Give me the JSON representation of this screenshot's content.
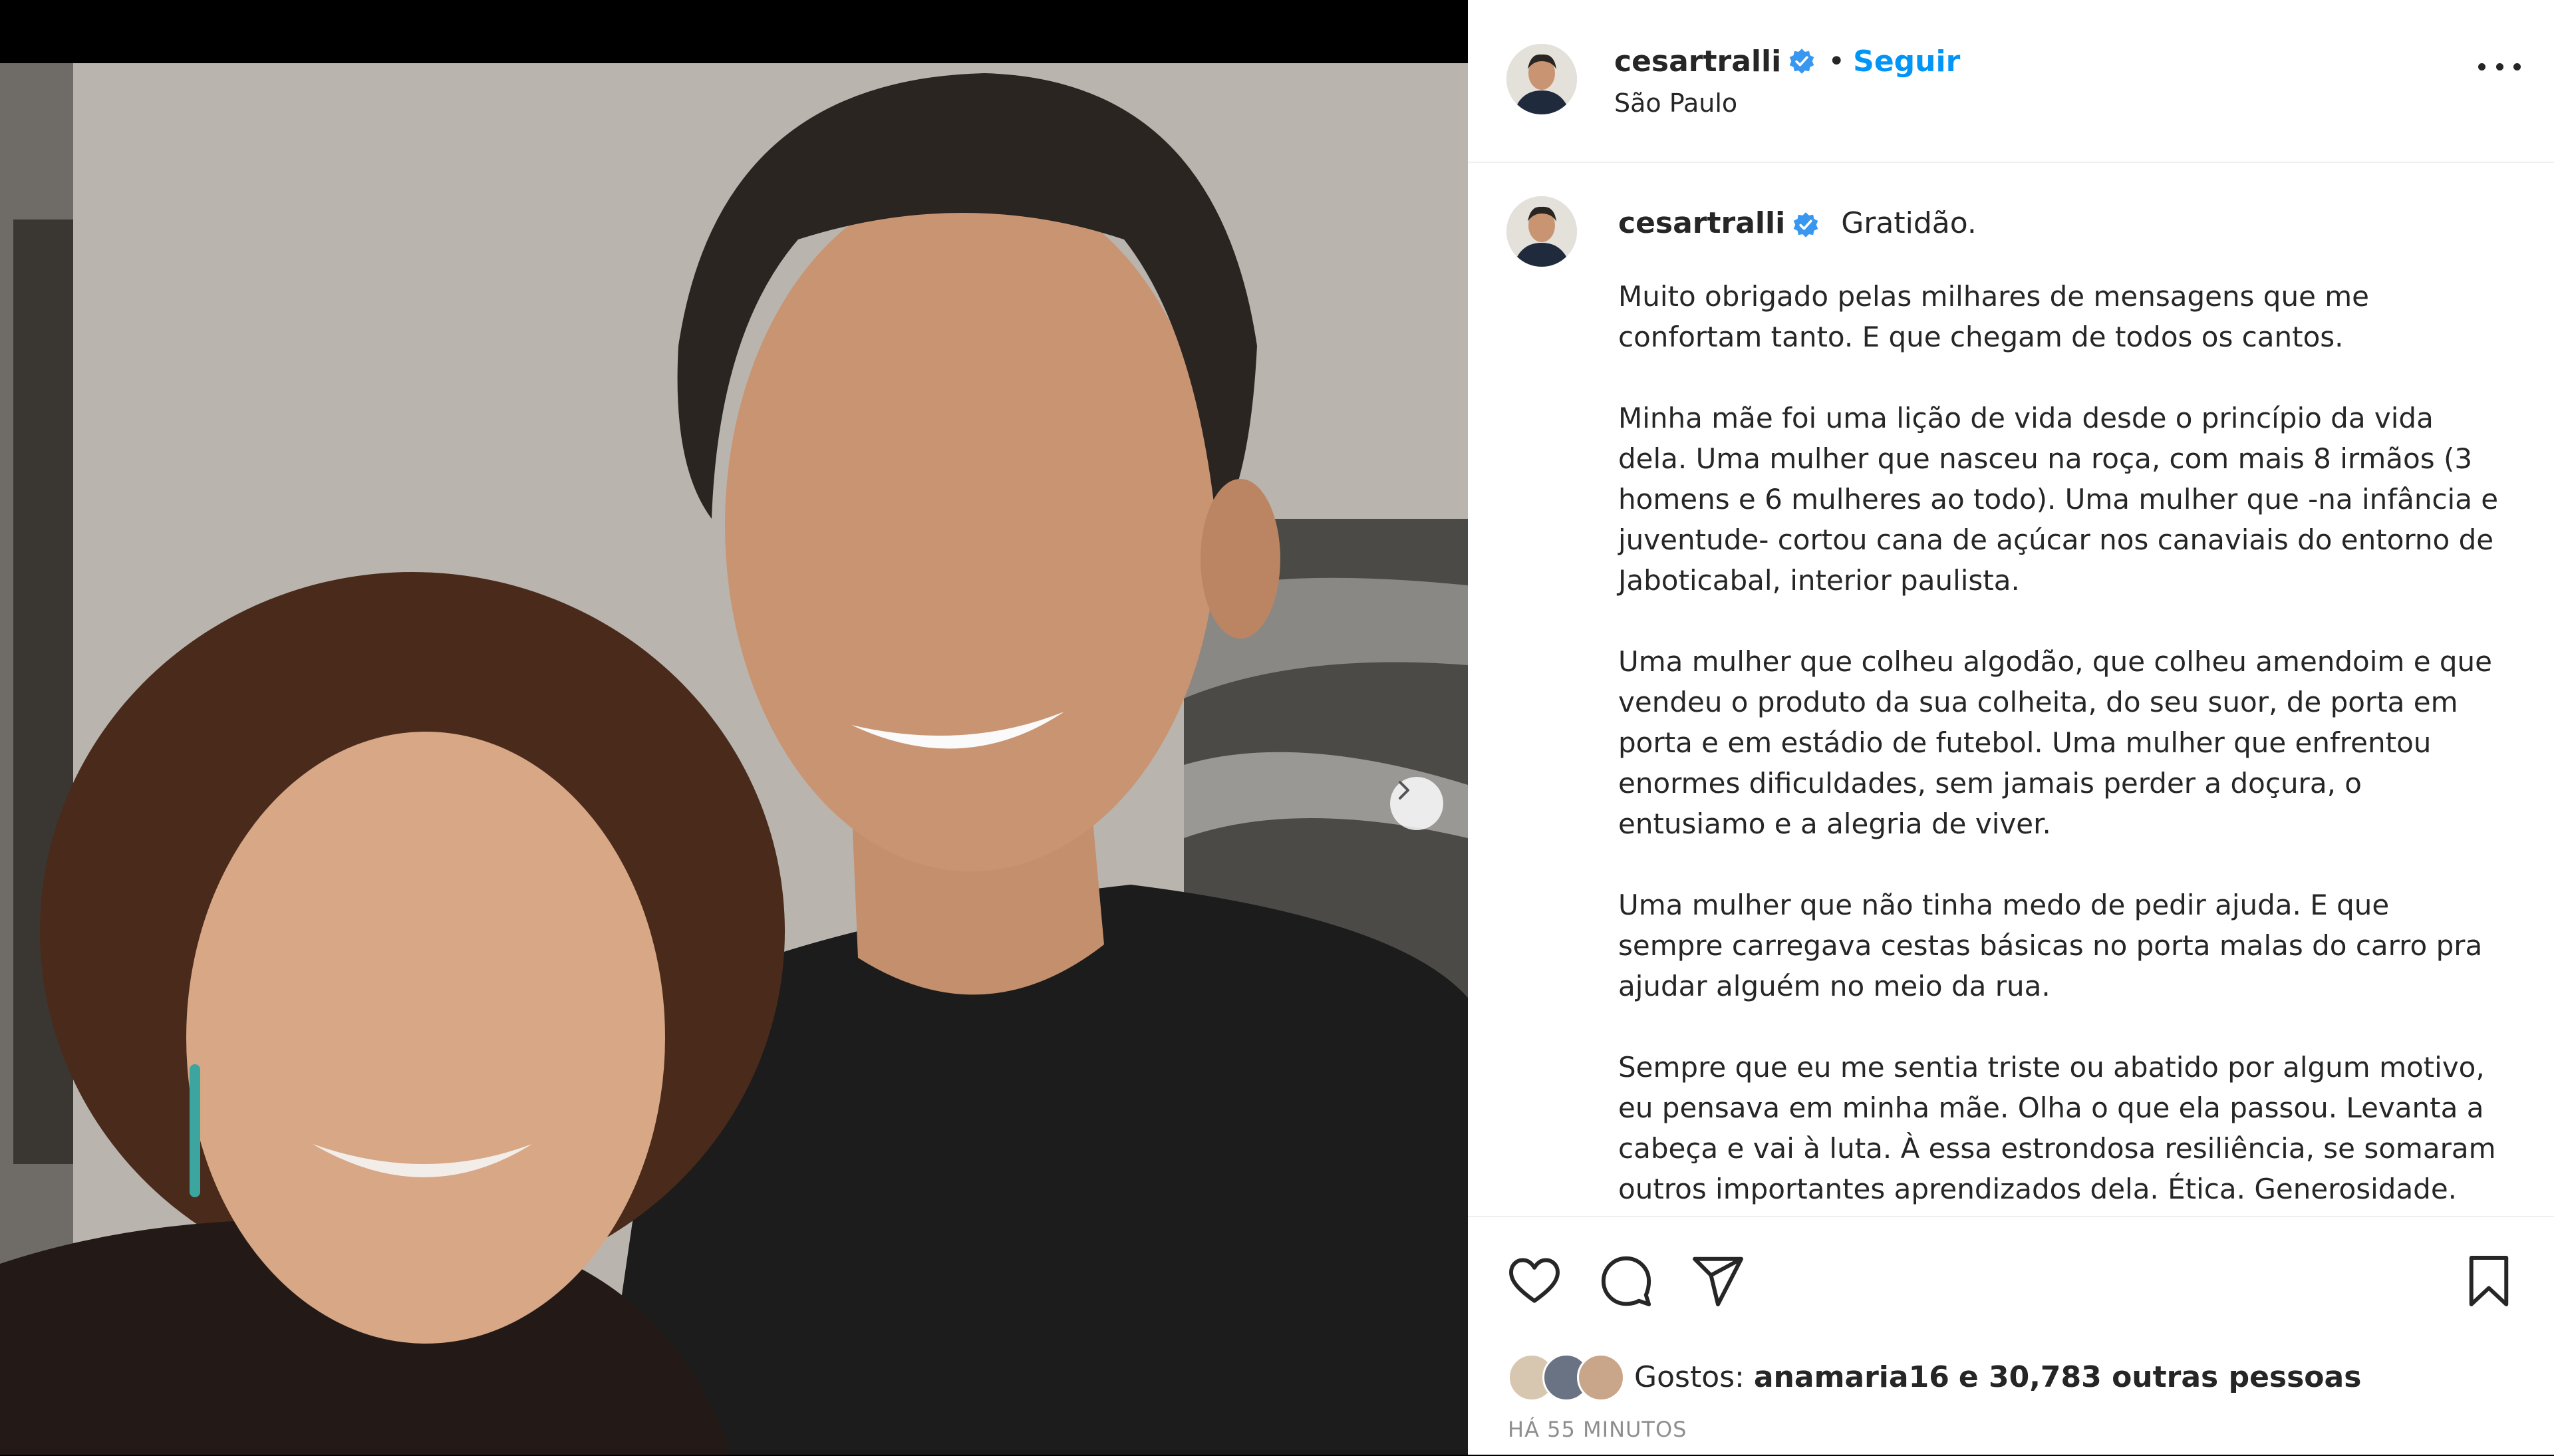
{
  "post": {
    "username": "cesartralli",
    "follow_label": "Seguir",
    "separator": "•",
    "location": "São Paulo"
  },
  "caption": {
    "username": "cesartralli",
    "title": "Gratidão.",
    "paragraphs": [
      "Muito obrigado pelas milhares de mensagens que me confortam tanto. E que chegam de todos os cantos.",
      "Minha mãe foi uma lição de vida desde o princípio da vida dela. Uma mulher que nasceu na roça, com mais 8 irmãos (3 homens e 6 mulheres ao todo). Uma mulher que -na infância e juventude- cortou cana de açúcar nos canaviais do entorno de Jaboticabal, interior paulista.",
      "Uma mulher que colheu algodão, que colheu amendoim e que vendeu o produto da sua colheita, do seu suor, de porta em porta e em estádio de futebol. Uma mulher que enfrentou enormes dificuldades, sem jamais perder a doçura, o entusiamo e a alegria de viver.",
      "Uma mulher que não tinha medo de pedir ajuda. E que sempre carregava cestas básicas no porta malas do carro pra ajudar alguém no meio da rua.",
      "Sempre que eu me sentia triste ou abatido por algum motivo, eu pensava em minha mãe. Olha o que ela passou. Levanta a cabeça e vai à luta. À essa estrondosa resiliência, se somaram outros importantes aprendizados dela. Ética. Generosidade."
    ]
  },
  "likes": {
    "prefix": "Gostos:",
    "first_user": "anamaria16",
    "rest": "e 30,783 outras pessoas"
  },
  "timestamp": "HÁ 55 MINUTOS",
  "icons": [
    "verified-badge-icon",
    "more-options-icon",
    "next-photo-icon",
    "heart-icon",
    "comment-icon",
    "share-icon",
    "bookmark-icon"
  ],
  "colors": {
    "link": "#0095f6",
    "verified": "#3897f0",
    "text": "#262626",
    "muted": "#8e8e8e"
  }
}
